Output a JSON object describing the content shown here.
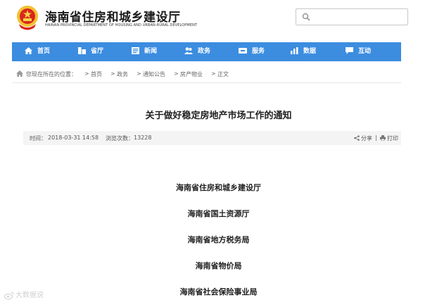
{
  "header": {
    "title": "海南省住房和城乡建设厅",
    "subtitle": "HAINAN PROVINCIAL DEPARTMENT OF HOUSING AND URBAN-RURAL DEVELOPMENT",
    "search": {
      "icon": "search-icon",
      "value": ""
    }
  },
  "nav": {
    "items": [
      {
        "label": "首页",
        "icon": "home-icon"
      },
      {
        "label": "省厅",
        "icon": "building-icon"
      },
      {
        "label": "新闻",
        "icon": "newspaper-icon"
      },
      {
        "label": "政务",
        "icon": "people-icon"
      },
      {
        "label": "服务",
        "icon": "service-icon"
      },
      {
        "label": "数据",
        "icon": "bar-chart-icon"
      },
      {
        "label": "互动",
        "icon": "chat-icon"
      }
    ],
    "color": "#3c8de0"
  },
  "breadcrumb": {
    "prefix": "您现在所在的位置：",
    "items": [
      "首页",
      "政务",
      "通知公告",
      "房产物业",
      "正文"
    ],
    "separator": ">"
  },
  "article": {
    "title": "关于做好稳定房地产市场工作的通知",
    "time_label": "时间：",
    "time": "2018-03-31 14:58",
    "views_label": "浏览次数：",
    "views": "13228",
    "share_label": "分享",
    "divider": "|",
    "print_label": "打印"
  },
  "organizations": [
    "海南省住房和城乡建设厅",
    "海南省国土资源厅",
    "海南省地方税务局",
    "海南省物价局",
    "海南省社会保险事业局"
  ],
  "watermark": "大数据说"
}
